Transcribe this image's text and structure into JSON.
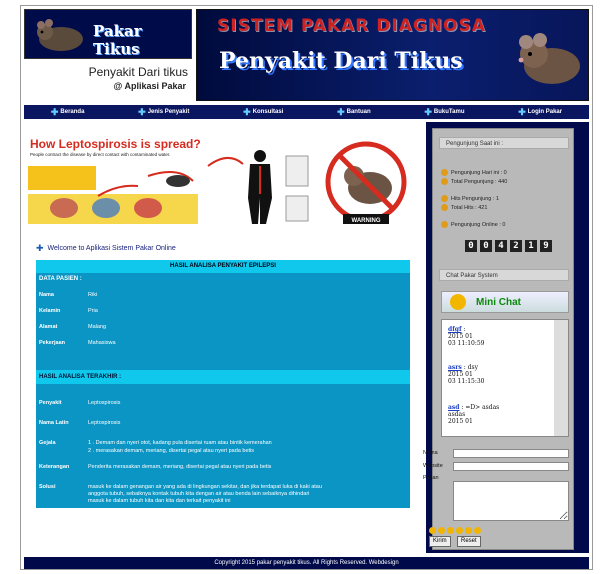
{
  "header": {
    "logo_text": "Pakar Tikus",
    "tagline": "Penyakit Dari tikus",
    "tagline_sub": "@ Aplikasi Pakar",
    "banner_title": "SISTEM PAKAR DIAGNOSA",
    "banner_subtitle": "Penyakit Dari Tikus"
  },
  "nav": {
    "items": [
      "Beranda",
      "Jenis Penyakit",
      "Konsultasi",
      "Bantuan",
      "BukuTamu",
      "Login Pakar"
    ]
  },
  "infographic": {
    "title": "How Leptospirosis is spread?",
    "subtitle": "People contract the disease by direct contact with contaminated water.",
    "warning": "WARNING"
  },
  "welcome": "Welcome to Aplikasi Sistem Pakar Online",
  "result": {
    "title": "HASIL ANALISA PENYAKIT EPILEPSI",
    "patient_header": "DATA PASIEN :",
    "patient": [
      {
        "label": "Nama",
        "value": "Riki"
      },
      {
        "label": "Kelamin",
        "value": "Pria"
      },
      {
        "label": "Alamat",
        "value": "Malang"
      },
      {
        "label": "Pekerjaan",
        "value": "Mahasiswa"
      }
    ],
    "analysis_header": "HASIL ANALISA TERAKHIR :",
    "analysis": [
      {
        "label": "Penyakit",
        "value": "Leptospirosis"
      },
      {
        "label": "Nama Latin",
        "value": "Leptospirosis"
      },
      {
        "label": "Gejala",
        "value": "1 . Demam dan nyeri otot, kadang pula disertai ruam atau bintik kemerahan"
      },
      {
        "label": "",
        "value": "2 . merasakan demam, meriang, disertai pegal atau nyeri pada betis"
      },
      {
        "label": "Keterangan",
        "value": "Penderita merasakan demam, meriang, disertai pegal atau nyeri pada betis"
      },
      {
        "label": "Solusi",
        "value": "masuk ke dalam genangan air yang ada di lingkungan sekitar, dan jika terdapat luka di kaki atau"
      },
      {
        "label": "",
        "value": "anggota tubuh, sebaiknya kontak tubuh kita dengan air atau benda lain sebaiknya dihindari"
      },
      {
        "label": "",
        "value": "masuk ke dalam tubuh kita dan kita dan terkait penyakit ini"
      }
    ]
  },
  "sidebar": {
    "visitor_header": "Pengunjung Saat ini :",
    "stats": [
      "Pengunjung Hari ini : 0",
      "Total Pengunjung : 440",
      "Hits Pengunjung : 1",
      "Total Hits : 421",
      "Pengunjung Online : 0"
    ],
    "counter": [
      "0",
      "0",
      "4",
      "2",
      "1",
      "9"
    ],
    "chat_header": "Chat Pakar System",
    "minichat_label": "Mini Chat",
    "messages": [
      {
        "user": "dfgf",
        "text": ":",
        "date": "2015 01",
        "time": "03 11:10:59"
      },
      {
        "user": "asrs",
        "text": ": dsy",
        "date": "2015 01",
        "time": "03 11:15:30"
      },
      {
        "user": "asd",
        "text": ": =D> asdas",
        "date": "asdas",
        "time": "2015 01"
      }
    ],
    "form": {
      "nama_label": "Nama",
      "website_label": "Website",
      "pesan_label": "Pesan",
      "kirim_label": "Kirim",
      "reset_label": "Reset"
    }
  },
  "footer": "Copyright 2015 pakar penyakit tikus. All Rights Reserved. Webdesign"
}
